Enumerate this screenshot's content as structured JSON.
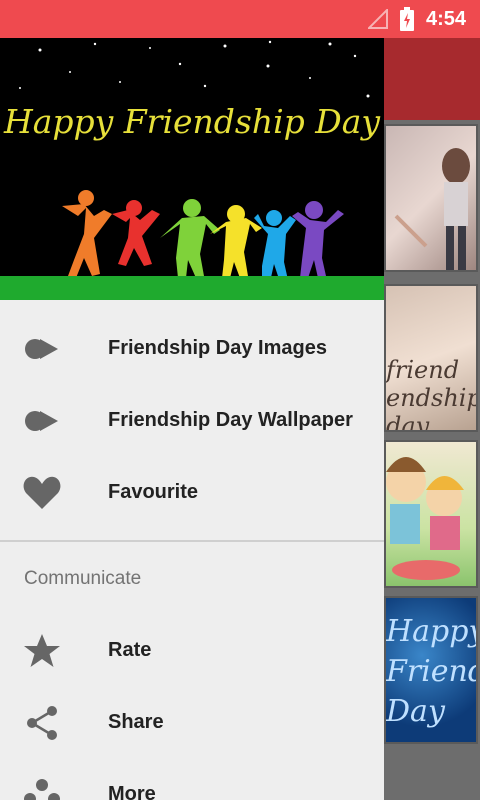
{
  "status_bar": {
    "time": "4:54",
    "color": "#ef4a4f"
  },
  "drawer": {
    "header_title": "Happy Friendship Day",
    "menu": [
      {
        "label": "Friendship Day Images",
        "icon": "record-forward-icon"
      },
      {
        "label": "Friendship Day Wallpaper",
        "icon": "record-forward-icon"
      },
      {
        "label": "Favourite",
        "icon": "heart-icon"
      }
    ],
    "section_header": "Communicate",
    "communicate": [
      {
        "label": "Rate",
        "icon": "star-icon"
      },
      {
        "label": "Share",
        "icon": "share-icon"
      },
      {
        "label": "More",
        "icon": "people-icon"
      }
    ]
  },
  "background_app": {
    "toolbar_color": "#a72a2e",
    "cards": [
      {
        "caption": ""
      },
      {
        "caption": "friend\nendship\nday"
      },
      {
        "caption": ""
      },
      {
        "caption": "Happy\nFriendship\nDay"
      }
    ]
  }
}
